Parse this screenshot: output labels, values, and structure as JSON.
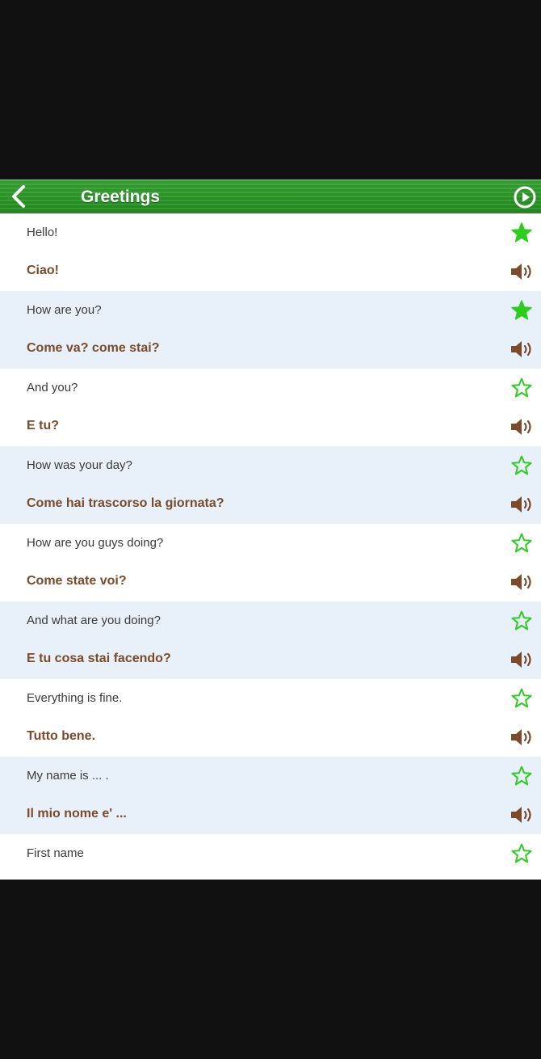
{
  "header": {
    "title": "Greetings",
    "back_icon": "chevron-left-icon",
    "play_icon": "play-circle-icon",
    "bar_color": "#2d9a2a"
  },
  "colors": {
    "phrase_text": "#3a3a3a",
    "translation_text": "#7a4a2a",
    "alt_row_bg": "#e8f1fa",
    "star": "#2ecc1f",
    "speaker": "#7a4a2a"
  },
  "phrases": [
    {
      "english": "Hello!",
      "italian": "Ciao!",
      "favorite": true
    },
    {
      "english": "How are you?",
      "italian": "Come va? come stai?",
      "favorite": true
    },
    {
      "english": "And you?",
      "italian": "E tu?",
      "favorite": false
    },
    {
      "english": "How was your day?",
      "italian": "Come hai trascorso la giornata?",
      "favorite": false
    },
    {
      "english": "How are you guys doing?",
      "italian": "Come state voi?",
      "favorite": false
    },
    {
      "english": "And what are you doing?",
      "italian": "E tu cosa stai facendo?",
      "favorite": false
    },
    {
      "english": "Everything is fine.",
      "italian": "Tutto bene.",
      "favorite": false
    },
    {
      "english": "My name is ... .",
      "italian": "Il mio nome e' ...",
      "favorite": false
    },
    {
      "english": "First name",
      "italian": "",
      "favorite": false
    }
  ]
}
